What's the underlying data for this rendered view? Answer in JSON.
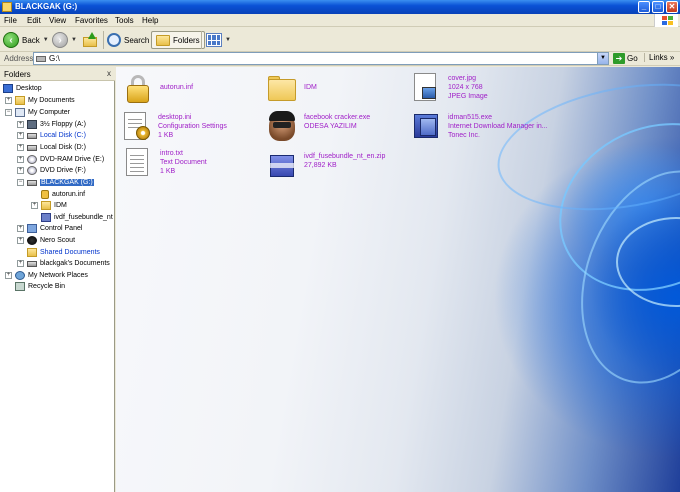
{
  "window": {
    "title": "BLACKGAK (G:)",
    "minimize_glyph": "_",
    "maximize_glyph": "□",
    "close_glyph": "✕"
  },
  "menu": {
    "items": [
      "File",
      "Edit",
      "View",
      "Favorites",
      "Tools",
      "Help"
    ]
  },
  "toolbar": {
    "back_label": "Back",
    "search_label": "Search",
    "folders_label": "Folders"
  },
  "address": {
    "label": "Address",
    "path": "G:\\",
    "go_label": "Go",
    "links_label": "Links",
    "links_glyph": "»"
  },
  "folders_pane": {
    "title": "Folders",
    "close_glyph": "x",
    "tree": [
      {
        "label": "Desktop",
        "expander": "",
        "icon": "desktop-icon"
      },
      {
        "label": "My Documents",
        "expander": "+",
        "icon": "folder-icon"
      },
      {
        "label": "My Computer",
        "expander": "−",
        "icon": "computer-icon"
      },
      {
        "label": "3½ Floppy (A:)",
        "expander": "+",
        "icon": "floppy-icon"
      },
      {
        "label": "Local Disk (C:)",
        "expander": "+",
        "icon": "drive-icon"
      },
      {
        "label": "Local Disk (D:)",
        "expander": "+",
        "icon": "drive-icon"
      },
      {
        "label": "DVD-RAM Drive (E:)",
        "expander": "+",
        "icon": "dvd-icon"
      },
      {
        "label": "DVD Drive (F:)",
        "expander": "+",
        "icon": "dvd-icon"
      },
      {
        "label": "BLACKGAK (G:)",
        "expander": "−",
        "icon": "drive-icon"
      },
      {
        "label": "autorun.inf",
        "expander": "",
        "icon": "lock-icon"
      },
      {
        "label": "IDM",
        "expander": "+",
        "icon": "folder-icon"
      },
      {
        "label": "ivdf_fusebundle_nt",
        "expander": "",
        "icon": "zip-icon"
      },
      {
        "label": "Control Panel",
        "expander": "+",
        "icon": "control-panel-icon"
      },
      {
        "label": "Nero Scout",
        "expander": "+",
        "icon": "nero-icon"
      },
      {
        "label": "Shared Documents",
        "expander": "",
        "icon": "folder-icon"
      },
      {
        "label": "blackgak's Documents",
        "expander": "+",
        "icon": "folder-icon"
      },
      {
        "label": "My Network Places",
        "expander": "+",
        "icon": "network-icon"
      },
      {
        "label": "Recycle Bin",
        "expander": "",
        "icon": "recycle-bin-icon"
      }
    ]
  },
  "files": [
    {
      "name": "autorun.inf",
      "line2": "",
      "line3": "",
      "icon": "lock-icon"
    },
    {
      "name": "IDM",
      "line2": "",
      "line3": "",
      "icon": "folder-icon"
    },
    {
      "name": "cover.jpg",
      "line2": "1024 x 768",
      "line3": "JPEG Image",
      "icon": "image-icon"
    },
    {
      "name": "desktop.ini",
      "line2": "Configuration Settings",
      "line3": "1 KB",
      "icon": "settings-file-icon"
    },
    {
      "name": "facebook cracker.exe",
      "line2": "ODESA YAZILIM",
      "line3": "",
      "icon": "masked-face-icon"
    },
    {
      "name": "idman515.exe",
      "line2": "Internet Download Manager in...",
      "line3": "Tonec Inc.",
      "icon": "installer-icon"
    },
    {
      "name": "intro.txt",
      "line2": "Text Document",
      "line3": "1 KB",
      "icon": "text-file-icon"
    },
    {
      "name": "ivdf_fusebundle_nt_en.zip",
      "line2": "27,892 KB",
      "line3": "",
      "icon": "zip-archive-icon"
    }
  ],
  "colors": {
    "title_bar": "#0a52d6",
    "selection": "#316ac5",
    "compressed_text": "#a020c8",
    "link_blue": "#0033cc"
  }
}
